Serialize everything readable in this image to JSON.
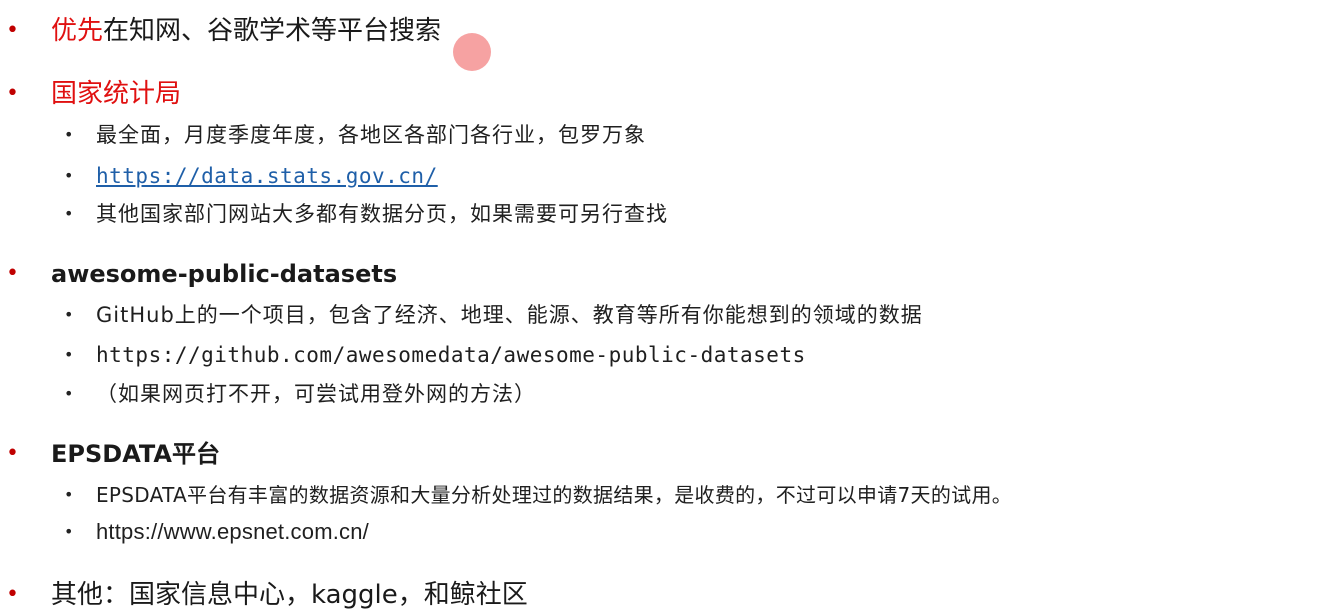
{
  "items": [
    {
      "bullet": "•",
      "highlight": "优先",
      "rest": "在知网、谷歌学术等平台搜索"
    },
    {
      "bullet": "•",
      "title": "国家统计局",
      "sub": [
        "最全面，月度季度年度，各地区各部门各行业，包罗万象",
        "https://data.stats.gov.cn/",
        "其他国家部门网站大多都有数据分页，如果需要可另行查找"
      ]
    },
    {
      "bullet": "•",
      "title": "awesome-public-datasets",
      "sub": [
        "GitHub上的一个项目，包含了经济、地理、能源、教育等所有你能想到的领域的数据",
        "https://github.com/awesomedata/awesome-public-datasets",
        "（如果网页打不开，可尝试用登外网的方法）"
      ]
    },
    {
      "bullet": "•",
      "title": "EPSDATA平台",
      "sub": [
        "EPSDATA平台有丰富的数据资源和大量分析处理过的数据结果，是收费的，不过可以申请7天的试用。",
        "https://www.epsnet.com.cn/"
      ]
    },
    {
      "bullet": "•",
      "title": "其他：国家信息中心，kaggle，和鲸社区"
    }
  ],
  "sub_bullet": "•",
  "colors": {
    "accent_red": "#e01010",
    "link_blue": "#1f5fa8"
  }
}
